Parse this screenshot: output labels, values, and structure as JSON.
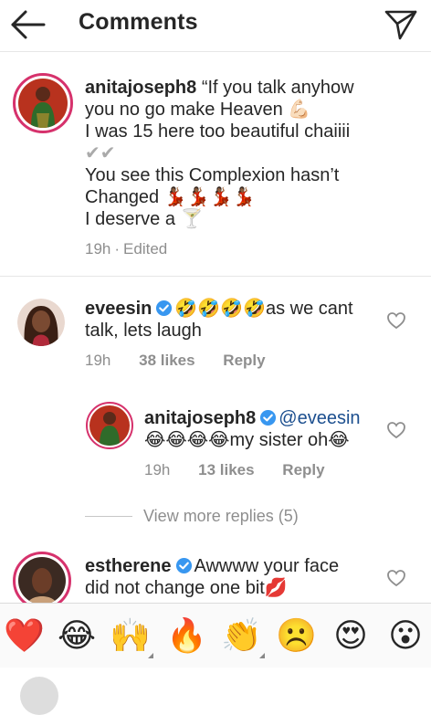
{
  "header": {
    "title": "Comments"
  },
  "caption": {
    "username": "anitajoseph8",
    "lines": [
      "“If you talk anyhow",
      "you no go make Heaven 💪🏻",
      "I was 15 here too beautiful chaiiii",
      "✔✔",
      "You see this Complexion hasn’t",
      "Changed 💃🏾💃🏾💃🏾💃🏾",
      "I deserve a 🍸"
    ],
    "time": "19h",
    "edited": "Edited"
  },
  "comments": [
    {
      "username": "eveesin",
      "line1": "🤣🤣🤣🤣as we cant",
      "line2": "talk, lets laugh",
      "time": "19h",
      "likes": "38 likes",
      "reply": "Reply"
    },
    {
      "username": "anitajoseph8",
      "mention": "@eveesin",
      "line2": "😂😂😂😂my sister oh😂",
      "time": "19h",
      "likes": "13 likes",
      "reply": "Reply"
    },
    {
      "username": "estherene",
      "line1": "Awwww your face",
      "line2": "did not change one bit💋"
    }
  ],
  "view_more": "View more replies (5)",
  "emoji_bar": [
    "❤️",
    "😂",
    "🙌",
    "🔥",
    "👏",
    "☹️",
    "😍",
    "😮"
  ],
  "colors": {
    "accent": "#3897f0",
    "verified": "#3897f0",
    "story_ring": "#d6326c",
    "muted": "#8e8e8e"
  },
  "icons": {
    "back": "back-arrow-icon",
    "send": "send-icon",
    "heart": "heart-outline-icon"
  }
}
